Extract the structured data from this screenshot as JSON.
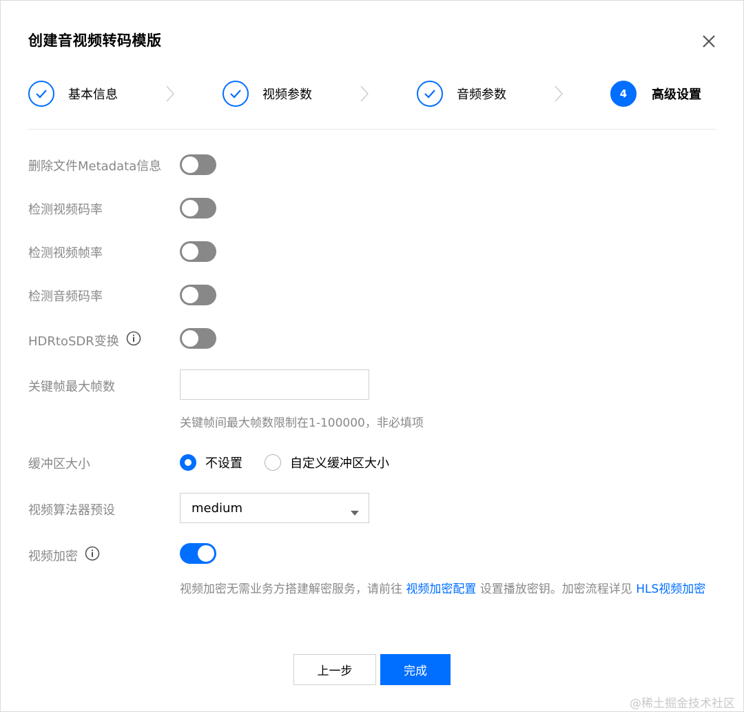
{
  "dialog": {
    "title": "创建音视频转码模版",
    "close_icon": "close-icon"
  },
  "steps": [
    {
      "label": "基本信息",
      "state": "done",
      "icon": "check-icon"
    },
    {
      "label": "视频参数",
      "state": "done",
      "icon": "check-icon"
    },
    {
      "label": "音频参数",
      "state": "done",
      "icon": "check-icon"
    },
    {
      "label": "高级设置",
      "state": "active",
      "number": "4"
    }
  ],
  "form": {
    "remove_metadata": {
      "label": "删除文件Metadata信息",
      "enabled": false
    },
    "detect_video_bitrate": {
      "label": "检测视频码率",
      "enabled": false
    },
    "detect_video_framerate": {
      "label": "检测视频帧率",
      "enabled": false
    },
    "detect_audio_bitrate": {
      "label": "检测音频码率",
      "enabled": false
    },
    "hdr_to_sdr": {
      "label": "HDRtoSDR变换",
      "enabled": false,
      "info_icon": "info-icon"
    },
    "max_keyframe_interval": {
      "label": "关键帧最大帧数",
      "value": "",
      "hint": "关键帧间最大帧数限制在1-100000，非必填项"
    },
    "buffer_size": {
      "label": "缓冲区大小",
      "options": [
        "不设置",
        "自定义缓冲区大小"
      ],
      "selected": "不设置"
    },
    "video_preset": {
      "label": "视频算法器预设",
      "selected": "medium"
    },
    "video_encryption": {
      "label": "视频加密",
      "enabled": true,
      "info_icon": "info-icon",
      "desc_part1": "视频加密无需业务方搭建解密服务，请前往 ",
      "link1": "视频加密配置",
      "desc_part2": " 设置播放密钥。加密流程详见 ",
      "link2": "HLS视频加密"
    }
  },
  "footer": {
    "prev_label": "上一步",
    "done_label": "完成"
  },
  "watermark": "@稀土掘金技术社区",
  "colors": {
    "accent": "#006eff",
    "toggle_off": "#888888",
    "muted_text": "#888888"
  }
}
